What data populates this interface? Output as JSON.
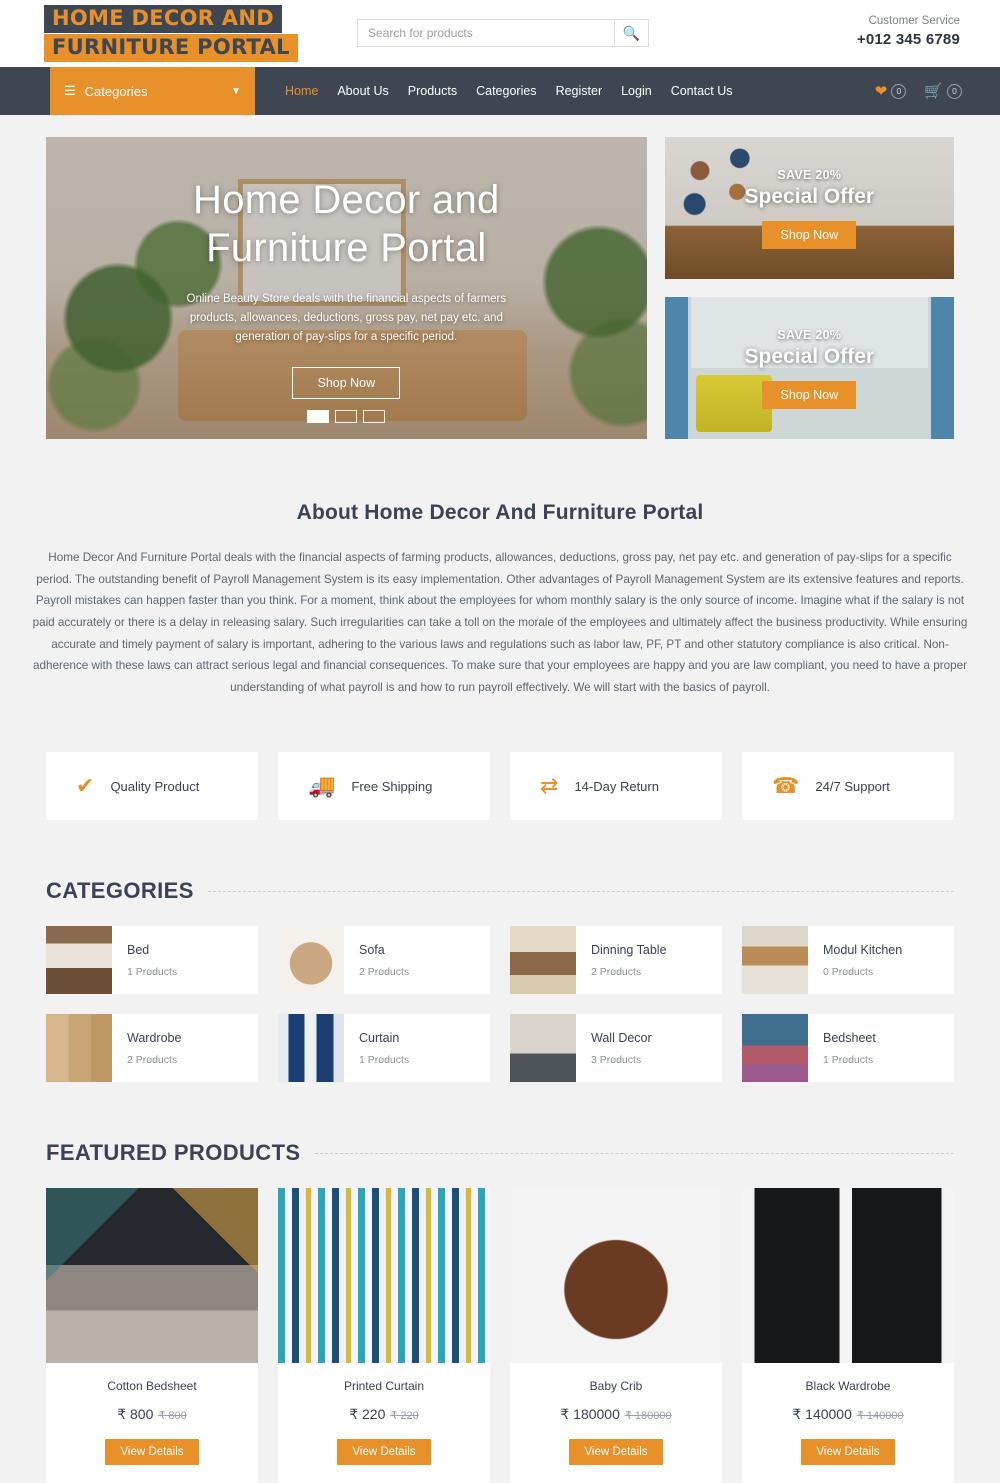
{
  "header": {
    "logo_line1": "HOME DECOR AND",
    "logo_line2": "FURNITURE PORTAL",
    "search_placeholder": "Search for products",
    "search_value": "",
    "search_icon": "search-icon",
    "customer_service_label": "Customer Service",
    "customer_service_phone": "+012 345 6789"
  },
  "nav": {
    "categories_label": "Categories",
    "burger_icon": "hamburger-icon",
    "chevron_icon": "chevron-down-icon",
    "links": [
      {
        "label": "Home",
        "active": true
      },
      {
        "label": "About Us",
        "active": false
      },
      {
        "label": "Products",
        "active": false
      },
      {
        "label": "Categories",
        "active": false
      },
      {
        "label": "Register",
        "active": false
      },
      {
        "label": "Login",
        "active": false
      },
      {
        "label": "Contact Us",
        "active": false
      }
    ],
    "wishlist_icon": "heart-icon",
    "wishlist_count": "0",
    "cart_icon": "cart-icon",
    "cart_count": "0"
  },
  "hero": {
    "title": "Home Decor and Furniture Portal",
    "subtitle": "Online Beauty Store deals with the financial aspects of farmers products, allowances, deductions, gross pay, net pay etc. and generation of pay-slips for a specific period.",
    "button": "Shop Now",
    "slides_total": 3,
    "active_slide": 1
  },
  "promos": [
    {
      "save": "SAVE 20%",
      "title": "Special Offer",
      "button": "Shop Now"
    },
    {
      "save": "SAVE 20%",
      "title": "Special Offer",
      "button": "Shop Now"
    }
  ],
  "about": {
    "heading": "About Home Decor And Furniture Portal",
    "body": "Home Decor And Furniture Portal deals with the financial aspects of farming products, allowances, deductions, gross pay, net pay etc. and generation of pay-slips for a specific period. The outstanding benefit of Payroll Management System is its easy implementation. Other advantages of Payroll Management System are its extensive features and reports. Payroll mistakes can happen faster than you think. For a moment, think about the employees for whom monthly salary is the only source of income. Imagine what if the salary is not paid accurately or there is a delay in releasing salary. Such irregularities can take a toll on the morale of the employees and ultimately affect the business productivity. While ensuring accurate and timely payment of salary is important, adhering to the various laws and regulations such as labor law, PF, PT and other statutory compliance is also critical. Non-adherence with these laws can attract serious legal and financial consequences. To make sure that your employees are happy and you are law compliant, you need to have a proper understanding of what payroll is and how to run payroll effectively. We will start with the basics of payroll."
  },
  "services": [
    {
      "icon": "checkmark-icon",
      "glyph": "✔",
      "label": "Quality Product"
    },
    {
      "icon": "truck-icon",
      "glyph": "🚚",
      "label": "Free Shipping"
    },
    {
      "icon": "exchange-arrows-icon",
      "glyph": "⇄",
      "label": "14-Day Return"
    },
    {
      "icon": "phone-icon",
      "glyph": "☎",
      "label": "24/7 Support"
    }
  ],
  "categories_section": {
    "heading": "CATEGORIES",
    "items": [
      {
        "name": "Bed",
        "count": "1 Products",
        "thumb": "bed-thumbnail"
      },
      {
        "name": "Sofa",
        "count": "2 Products",
        "thumb": "sofa-thumbnail"
      },
      {
        "name": "Dinning Table",
        "count": "2 Products",
        "thumb": "dinning-table-thumbnail"
      },
      {
        "name": "Modul Kitchen",
        "count": "0 Products",
        "thumb": "modul-kitchen-thumbnail"
      },
      {
        "name": "Wardrobe",
        "count": "2 Products",
        "thumb": "wardrobe-thumbnail"
      },
      {
        "name": "Curtain",
        "count": "1 Products",
        "thumb": "curtain-thumbnail"
      },
      {
        "name": "Wall Decor",
        "count": "3 Products",
        "thumb": "wall-decor-thumbnail"
      },
      {
        "name": "Bedsheet",
        "count": "1 Products",
        "thumb": "bedsheet-thumbnail"
      }
    ]
  },
  "products_section": {
    "heading": "FEATURED PRODUCTS",
    "items": [
      {
        "name": "Cotton Bedsheet",
        "price": "₹ 800",
        "old_price": "₹ 800",
        "button": "View Details",
        "image": "cotton-bedsheet-image"
      },
      {
        "name": "Printed Curtain",
        "price": "₹ 220",
        "old_price": "₹ 220",
        "button": "View Details",
        "image": "printed-curtain-image"
      },
      {
        "name": "Baby Crib",
        "price": "₹ 180000",
        "old_price": "₹ 180000",
        "button": "View Details",
        "image": "baby-crib-image"
      },
      {
        "name": "Black Wardrobe",
        "price": "₹ 140000",
        "old_price": "₹ 140000",
        "button": "View Details",
        "image": "black-wardrobe-image"
      }
    ]
  },
  "colors": {
    "accent": "#e8912a",
    "dark": "#3e4651",
    "page_bg": "#f2f2f2",
    "text": "#3a4256"
  }
}
